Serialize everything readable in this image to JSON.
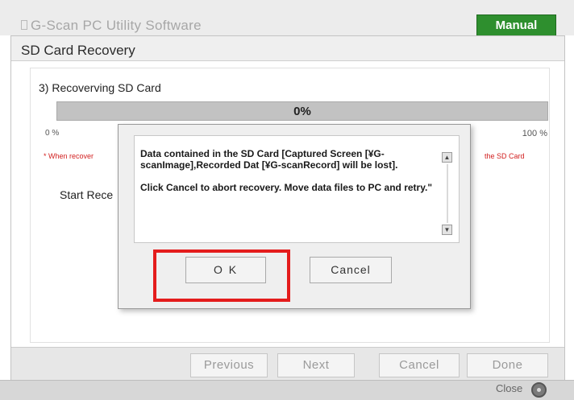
{
  "app": {
    "title": "G-Scan PC Utility Software",
    "manual_label": "Manual",
    "close_label": "Close"
  },
  "window": {
    "title": "SD Card Recovery",
    "step_heading": "3) Recoverving SD Card",
    "progress": {
      "value": 0,
      "text": "0%",
      "min_label": "0 %",
      "max_label": "100 %"
    },
    "warning_left": "* When recover",
    "warning_right": "the SD Card",
    "start_label": "Start Rece",
    "nav_buttons": [
      "Previous",
      "Next",
      "Cancel",
      "Done"
    ]
  },
  "dialog": {
    "message_1": "Data contained in the SD Card [Captured Screen [¥G-scanImage],Recorded Dat [¥G-scanRecord] will be lost].",
    "message_2": "Click Cancel to abort recovery.  Move data files to PC and retry.\"",
    "ok_label": "O K",
    "cancel_label": "Cancel"
  },
  "colors": {
    "manual_green": "#2e8f2e",
    "warning_red": "#d22020",
    "highlight_red": "#e41c1c"
  }
}
